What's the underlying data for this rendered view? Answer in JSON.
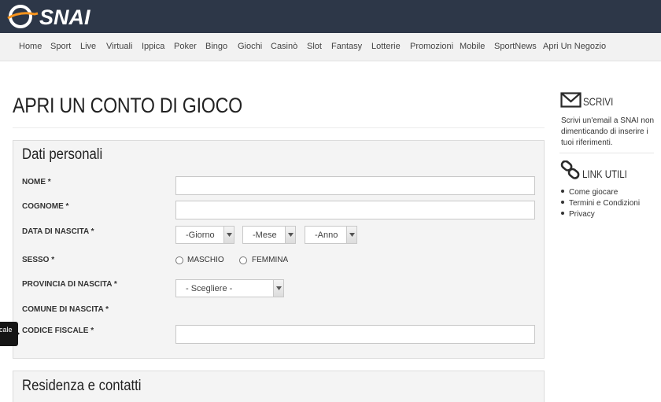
{
  "header": {
    "brand": "SNAI",
    "nav": [
      "Home",
      "Sport",
      "Live",
      "Virtuali",
      "Ippica",
      "Poker",
      "Bingo",
      "Giochi",
      "Casinò",
      "Slot",
      "Fantasy",
      "Lotterie",
      "Promozioni",
      "Mobile",
      "SportNews",
      "Apri Un Negozio"
    ]
  },
  "main": {
    "title": "APRI UN CONTO DI GIOCO",
    "personal": {
      "heading": "Dati personali",
      "nome_label": "NOME *",
      "nome_value": "",
      "cognome_label": "COGNOME *",
      "cognome_value": "",
      "nascita_label": "DATA DI NASCITA *",
      "day_select": "-Giorno",
      "month_select": "-Mese",
      "year_select": "-Anno",
      "sesso_label": "SESSO *",
      "maschio": "MASCHIO",
      "femmina": "FEMMINA",
      "provincia_label": "PROVINCIA DI NASCITA *",
      "provincia_select": "- Scegliere -",
      "comune_label": "COMUNE DI NASCITA *",
      "codice_label": "CODICE FISCALE *",
      "codice_value": ""
    },
    "residence": {
      "heading": "Residenza e contatti"
    },
    "tooltip": "cale"
  },
  "sidebar": {
    "scrivi_title": "SCRIVI",
    "scrivi_text": "Scrivi un'email a SNAI non dimenticando di inserire i tuoi riferimenti.",
    "links_title": "LINK UTILI",
    "links": [
      "Come giocare",
      "Termini e Condizioni",
      "Privacy"
    ]
  }
}
